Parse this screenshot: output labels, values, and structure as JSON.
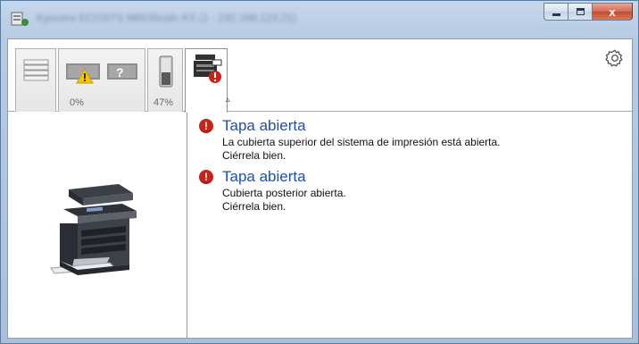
{
  "window": {
    "title": "Kyocera ECOSYS M6535cidn KX (1 - 192.168.123.21)",
    "buttons": {
      "minimize": "minimize",
      "maximize": "maximize",
      "close": "x"
    }
  },
  "toolbar": {
    "tabs": [
      {
        "name": "paper-tab",
        "percent": ""
      },
      {
        "name": "toner-tab",
        "percent": "0%",
        "warning": true
      },
      {
        "name": "waste-toner-tab",
        "percent": "47%"
      },
      {
        "name": "status-tab",
        "percent": "",
        "error": true,
        "active": true
      }
    ],
    "collapse_glyph": "▵",
    "gear_icon": "gear-icon"
  },
  "messages": [
    {
      "title": "Tapa abierta",
      "lines": [
        "La cubierta superior del sistema de impresión está abierta.",
        "Ciérrela bien."
      ]
    },
    {
      "title": "Tapa abierta",
      "lines": [
        "Cubierta posterior abierta.",
        "Ciérrela bien."
      ]
    }
  ],
  "colors": {
    "title_link": "#1f4fa8",
    "error_red": "#c8241c",
    "warning_yellow": "#f5c400"
  }
}
